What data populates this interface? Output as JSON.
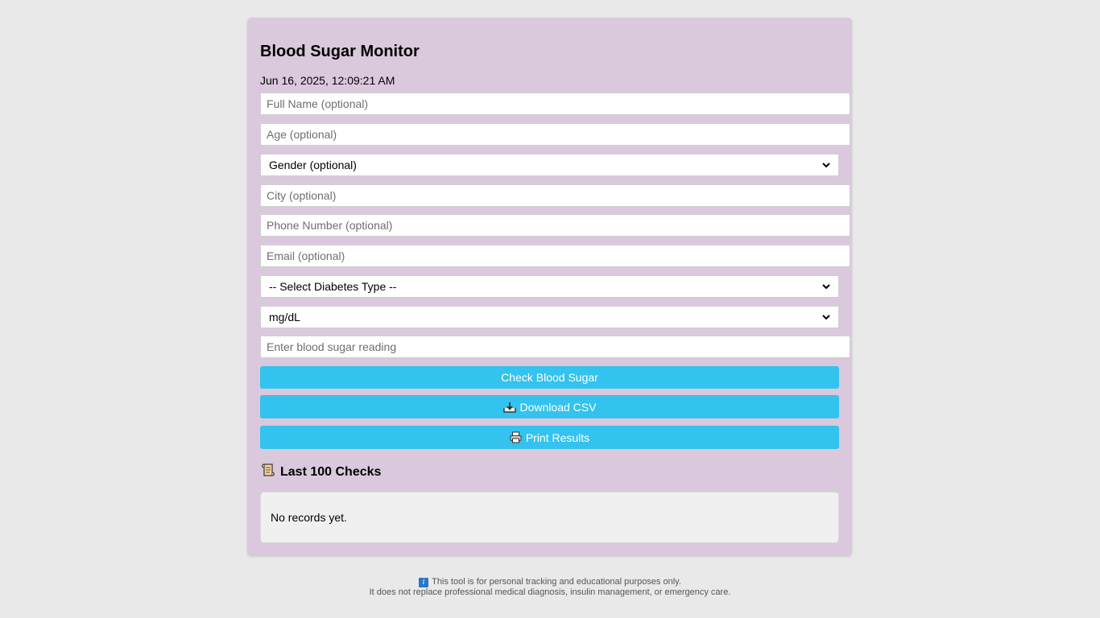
{
  "app": {
    "title": "Blood Sugar Monitor",
    "datetime": "Jun 16, 2025, 12:09:21 AM"
  },
  "form": {
    "full_name_placeholder": "Full Name (optional)",
    "age_placeholder": "Age (optional)",
    "gender_selected": "Gender (optional)",
    "city_placeholder": "City (optional)",
    "phone_placeholder": "Phone Number (optional)",
    "email_placeholder": "Email (optional)",
    "diabetes_type_selected": "-- Select Diabetes Type --",
    "unit_selected": "mg/dL",
    "reading_placeholder": "Enter blood sugar reading"
  },
  "buttons": {
    "check_label": "Check Blood Sugar",
    "download_label": "Download CSV",
    "download_icon": "download-tray-icon",
    "print_label": "Print Results",
    "print_icon": "printer-icon"
  },
  "history": {
    "title": "Last 100 Checks",
    "icon": "scroll-icon",
    "empty_message": "No records yet."
  },
  "footer": {
    "icon": "info-icon",
    "line1": "This tool is for personal tracking and educational purposes only.",
    "line2": "It does not replace professional medical diagnosis, insulin management, or emergency care."
  },
  "colors": {
    "background": "#e9e9e9",
    "card": "#dac9dc",
    "button": "#33c3ee",
    "button_text": "#ffffff",
    "records_panel": "#f0f0f0"
  }
}
